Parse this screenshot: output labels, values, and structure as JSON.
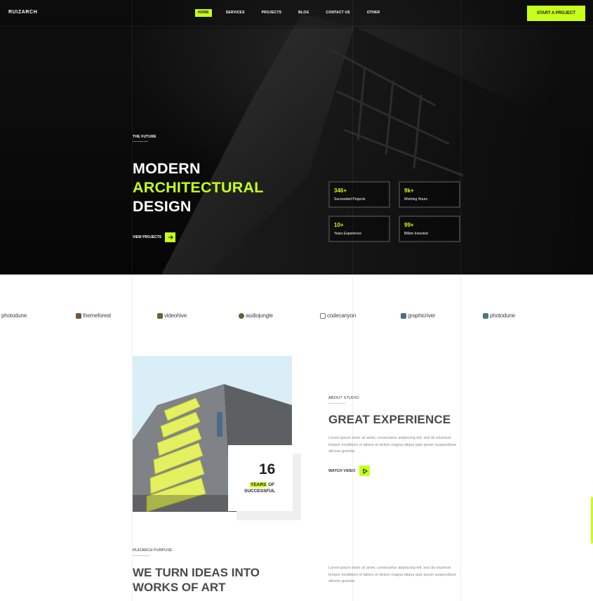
{
  "header": {
    "logo": "RUIZARCH",
    "nav": [
      {
        "label": "HOME",
        "active": true
      },
      {
        "label": "SERVICES",
        "active": false
      },
      {
        "label": "PROJECTS",
        "active": false
      },
      {
        "label": "BLOG",
        "active": false
      },
      {
        "label": "CONTACT US",
        "active": false
      },
      {
        "label": "OTHER",
        "active": false
      }
    ],
    "cta_label": "START A PROJECT"
  },
  "hero": {
    "eyebrow": "THE FUTURE",
    "title_line1": "MODERN",
    "title_line2": "ARCHITECTURAL",
    "title_line3": "DESIGN",
    "view_projects_label": "VIEW PROJECTS",
    "stats": [
      {
        "value": "346+",
        "label": "Succeeded Projects"
      },
      {
        "value": "9k+",
        "label": "Working Hours"
      },
      {
        "value": "10+",
        "label": "Years Experience"
      },
      {
        "value": "99+",
        "label": "Billion Invested"
      }
    ]
  },
  "brands": [
    {
      "name": "photodune",
      "icon": "photodune-icon"
    },
    {
      "name": "themeforest",
      "icon": "themeforest-icon"
    },
    {
      "name": "videohive",
      "icon": "videohive-icon"
    },
    {
      "name": "audiojungle",
      "icon": "audiojungle-icon"
    },
    {
      "name": "codecanyon",
      "icon": "codecanyon-icon"
    },
    {
      "name": "graphicriver",
      "icon": "graphicriver-icon"
    },
    {
      "name": "photodune",
      "icon": "photodune-icon"
    }
  ],
  "about": {
    "years_number": "16",
    "years_highlight": "YEARS",
    "years_of": "OF",
    "years_successful": "SUCCESSFUL",
    "eyebrow": "ABOUT STUDIO",
    "title": "GREAT EXPERIENCE",
    "text": "Lorem ipsum dolor sit amet, consectetur adipiscing elit, sed do eiusmod tempor incididunt ut labore et dolore magna aliqua quis ipsum suspendisse ultrices gravida.",
    "watch_label": "WATCH VIDEO"
  },
  "purpose": {
    "eyebrow": "RUIZARCH PURPUSE",
    "title_line1": "WE TURN IDEAS INTO",
    "title_line2": "WORKS OF ART",
    "text": "Lorem ipsum dolor sit amet, consectetur adipiscing elit, sed do eiusmod tempor incididunt ut labore et dolore magna aliqua quis ipsum suspendisse ultrices gravida."
  },
  "colors": {
    "accent": "#c6ff1a",
    "dark": "#0a0a0a",
    "heading_gray": "#4a4a4a"
  }
}
